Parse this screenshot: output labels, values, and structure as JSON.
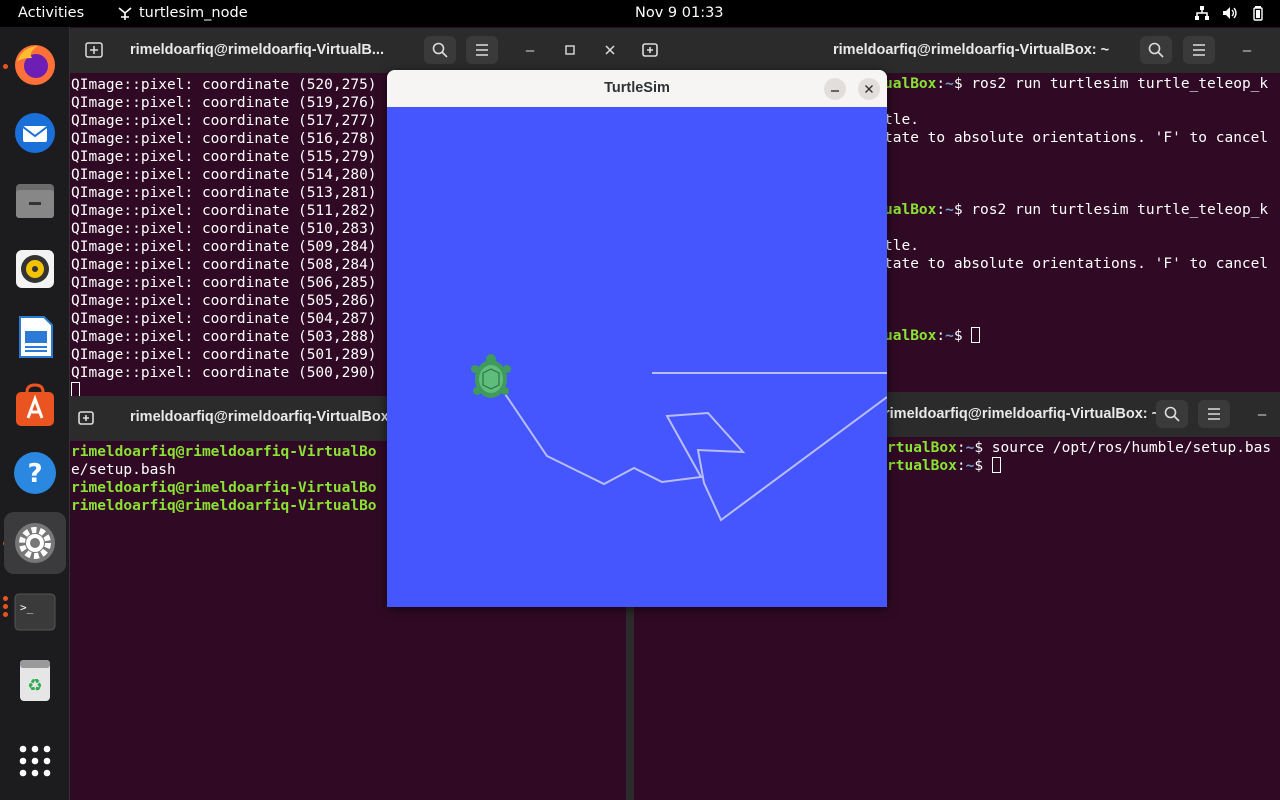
{
  "topbar": {
    "activities": "Activities",
    "app_name": "turtlesim_node",
    "clock": "Nov 9  01:33"
  },
  "dock": {
    "items": [
      "firefox-icon",
      "thunderbird-icon",
      "files-icon",
      "rhythmbox-icon",
      "writer-icon",
      "app-center-icon",
      "help-icon",
      "settings-icon",
      "terminal-icon",
      "trash-icon",
      "show-apps-icon"
    ]
  },
  "term1": {
    "title": "rimeldoarfiq@rimeldoarfiq-VirtualB...",
    "lines": [
      "QImage::pixel: coordinate (520,275)",
      "QImage::pixel: coordinate (519,276)",
      "QImage::pixel: coordinate (517,277)",
      "QImage::pixel: coordinate (516,278)",
      "QImage::pixel: coordinate (515,279)",
      "QImage::pixel: coordinate (514,280)",
      "QImage::pixel: coordinate (513,281)",
      "QImage::pixel: coordinate (511,282)",
      "QImage::pixel: coordinate (510,283)",
      "QImage::pixel: coordinate (509,284)",
      "QImage::pixel: coordinate (508,284)",
      "QImage::pixel: coordinate (506,285)",
      "QImage::pixel: coordinate (505,286)",
      "QImage::pixel: coordinate (504,287)",
      "QImage::pixel: coordinate (503,288)",
      "QImage::pixel: coordinate (501,289)",
      "QImage::pixel: coordinate (500,290)"
    ]
  },
  "term2": {
    "title": "rimeldoarfiq@rimeldoarfiq-VirtualBox: ~",
    "l1_tail": "ualBox",
    "l1_cmd": "$ ros2 run turtlesim turtle_teleop_k",
    "l2": "tle.",
    "l3": "tate to absolute orientations. 'F' to cancel",
    "l4_tail": "ualBox",
    "l4_cmd": "$ ros2 run turtlesim turtle_teleop_k",
    "l5": "tle.",
    "l6": "tate to absolute orientations. 'F' to cancel",
    "l7_tail": "ualBox",
    "l7_cmd": "$ ",
    "colon": ":",
    "tilde": "~"
  },
  "term3": {
    "title": "rimeldoarfiq@rimeldoarfiq-VirtualBox:",
    "l1": "rimeldoarfiq@rimeldoarfiq-VirtualBo",
    "l2": "e/setup.bash",
    "l3": "rimeldoarfiq@rimeldoarfiq-VirtualBo",
    "l4": "rimeldoarfiq@rimeldoarfiq-VirtualBo"
  },
  "term4": {
    "title": "rimeldoarfiq@rimeldoarfiq-VirtualBox: ~",
    "l1_tail": "rtualBox",
    "l1_cmd": "$ source /opt/ros/humble/setup.bas",
    "l2_tail": "rtualBox",
    "l2_cmd": "$ ",
    "colon": ":",
    "tilde": "~"
  },
  "turtlesim": {
    "title": "TurtleSim",
    "background_color": "#4556ff",
    "pen_color": "#b3b8ff"
  }
}
